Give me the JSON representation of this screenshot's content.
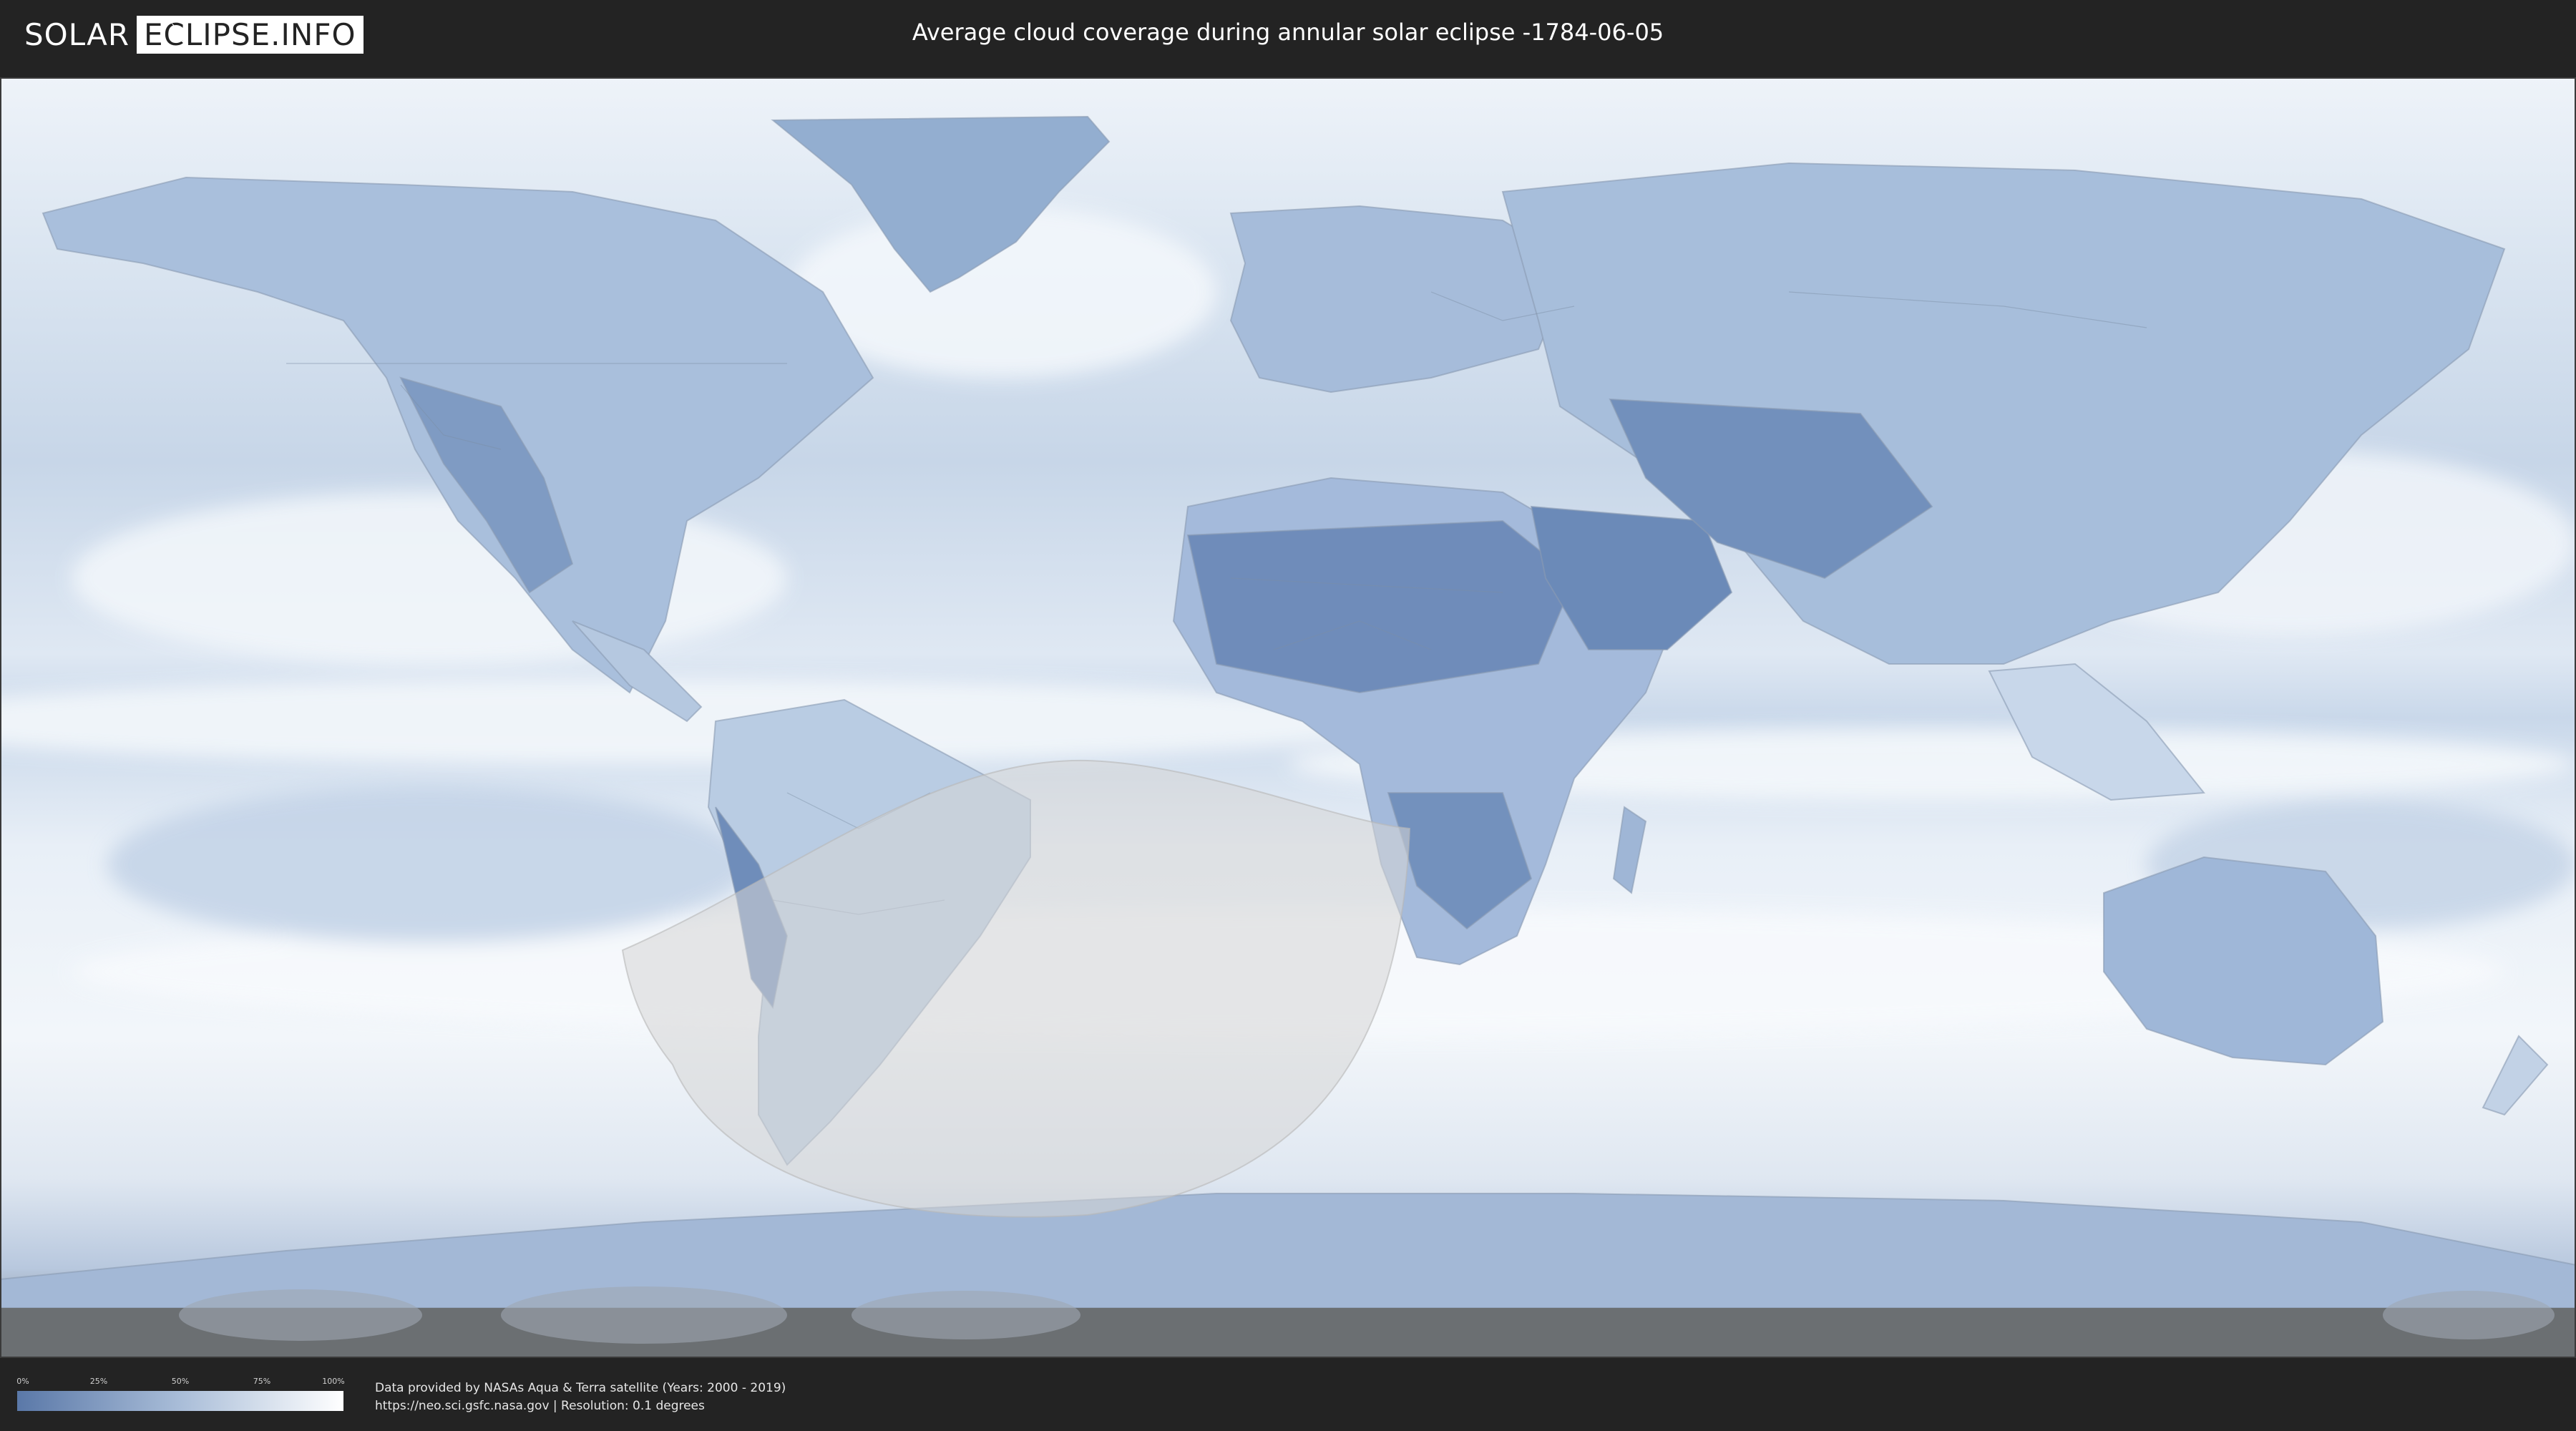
{
  "header": {
    "logo_left": "SOLAR",
    "logo_right": "ECLIPSE.INFO",
    "title": "Average cloud coverage during annular solar eclipse -1784-06-05"
  },
  "colors": {
    "background": "#232323",
    "cloud_low": "#5a78a8",
    "cloud_mid": "#a9bdd8",
    "cloud_high": "#ffffff",
    "eclipse_overlay": "#d6d6d6"
  },
  "legend": {
    "ticks": [
      "0%",
      "25%",
      "50%",
      "75%",
      "100%"
    ],
    "tick_values": [
      0,
      25,
      50,
      75,
      100
    ]
  },
  "footer": {
    "credit_line1": "Data provided by NASAs Aqua & Terra satellite (Years: 2000 - 2019)",
    "credit_line2": "https://neo.sci.gsfc.nasa.gov | Resolution: 0.1 degrees"
  },
  "icons": {
    "logo": "lightning-bolt-icon"
  }
}
